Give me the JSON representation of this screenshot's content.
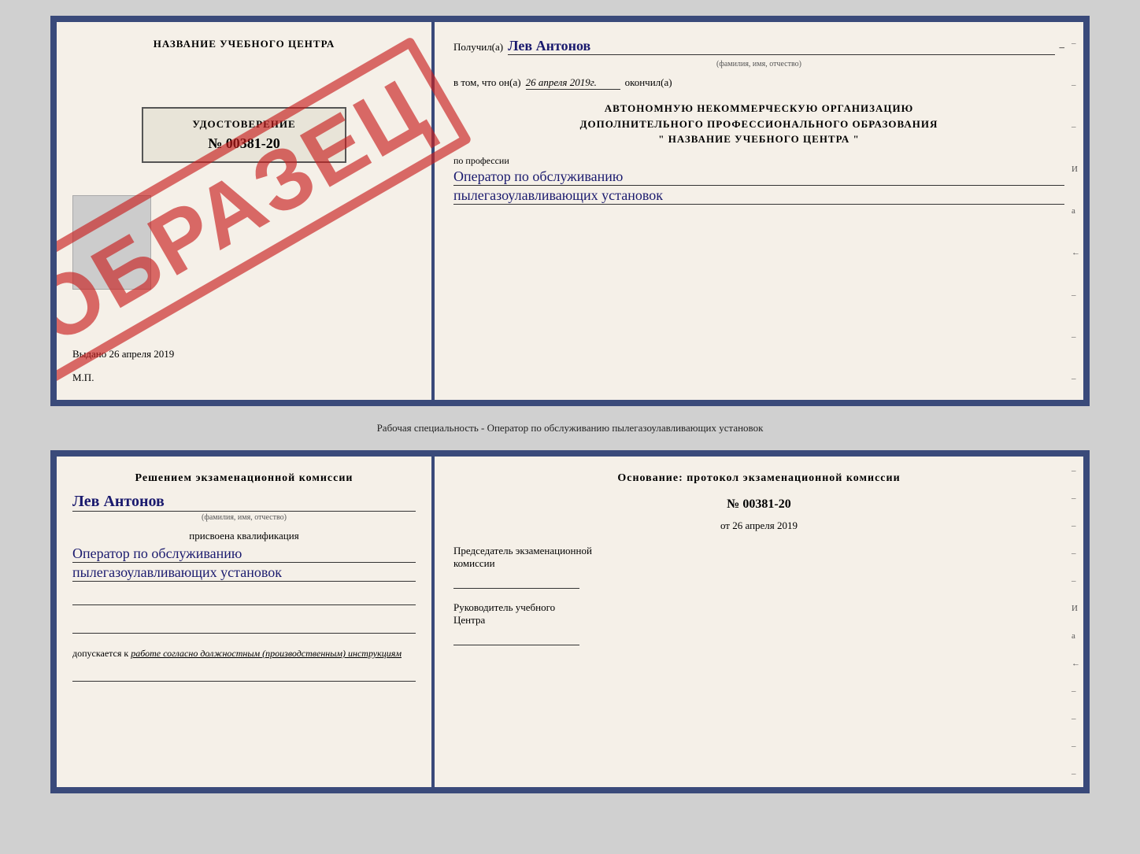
{
  "top_document": {
    "left": {
      "center_title": "НАЗВАНИЕ УЧЕБНОГО ЦЕНТРА",
      "stamp_text": "ОБРАЗЕЦ",
      "cert_title": "УДОСТОВЕРЕНИЕ",
      "cert_number": "№ 00381-20",
      "issued_label": "Выдано",
      "issued_date": "26 апреля 2019",
      "mp_label": "М.П."
    },
    "right": {
      "recipient_prefix": "Получил(а)",
      "recipient_name": "Лев Антонов",
      "fio_label": "(фамилия, имя, отчество)",
      "dash": "–",
      "date_prefix": "в том, что он(а)",
      "date_value": "26 апреля 2019г.",
      "completed_suffix": "окончил(а)",
      "org_title_line1": "АВТОНОМНУЮ НЕКОММЕРЧЕСКУЮ ОРГАНИЗАЦИЮ",
      "org_title_line2": "ДОПОЛНИТЕЛЬНОГО ПРОФЕССИОНАЛЬНОГО ОБРАЗОВАНИЯ",
      "org_title_line3": "\" НАЗВАНИЕ УЧЕБНОГО ЦЕНТРА \"",
      "and_label": "и",
      "small_label": "а",
      "arrow_label": "←",
      "profession_prefix": "по профессии",
      "profession_line1": "Оператор по обслуживанию",
      "profession_line2": "пылегазоулавливающих установок",
      "side_marks": [
        "-",
        "-",
        "-",
        "И",
        "а",
        "←",
        "-",
        "-",
        "-"
      ]
    }
  },
  "separator": {
    "text": "Рабочая специальность - Оператор по обслуживанию пылегазоулавливающих установок"
  },
  "bottom_document": {
    "left": {
      "decision_text": "Решением экзаменационной комиссии",
      "person_name": "Лев Антонов",
      "fio_label": "(фамилия, имя, отчество)",
      "assigned_label": "присвоена квалификация",
      "qual_line1": "Оператор по обслуживанию",
      "qual_line2": "пылегазоулавливающих установок",
      "blank_lines": 2,
      "admission_prefix": "допускается к",
      "admission_italic": "работе согласно должностным (производственным) инструкциям",
      "bottom_line": ""
    },
    "right": {
      "basis_text": "Основание: протокол экзаменационной комиссии",
      "protocol_number": "№ 00381-20",
      "date_prefix": "от",
      "date_value": "26 апреля 2019",
      "chairman_label1": "Председатель экзаменационной",
      "chairman_label2": "комиссии",
      "director_label1": "Руководитель учебного",
      "director_label2": "Центра",
      "side_marks": [
        "-",
        "-",
        "-",
        "-",
        "-",
        "И",
        "а",
        "←",
        "-",
        "-",
        "-",
        "-"
      ]
    }
  }
}
